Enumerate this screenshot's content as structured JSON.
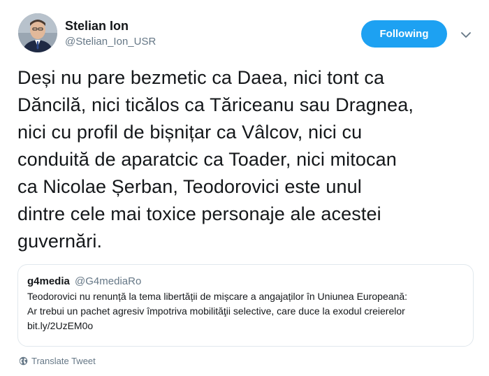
{
  "user": {
    "display_name": "Stelian Ion",
    "handle": "@Stelian_Ion_USR"
  },
  "follow_button": {
    "label": "Following",
    "color": "#1da1f2"
  },
  "tweet": {
    "lines": [
      "Deși nu pare bezmetic ca Daea, nici tont ca",
      "Dăncilă, nici ticălos ca Tăriceanu sau Dragnea,",
      "nici cu profil de bișnițar ca Vâlcov, nici cu",
      "conduită de aparatcic ca Toader, nici mitocan",
      "ca Nicolae Șerban, Teodorovici este unul",
      "dintre cele mai toxice personaje ale acestei",
      "guvernări."
    ]
  },
  "quote": {
    "name": "g4media",
    "handle": "@G4mediaRo",
    "lines": [
      "Teodorovici nu renunță la tema libertății de mișcare a angajaților în Uniunea Europeană:",
      "Ar trebui un pachet agresiv împotriva mobilităţii selective, care duce la exodul creierelor",
      "bit.ly/2UzEM0o"
    ]
  },
  "translate": {
    "label": "Translate Tweet",
    "icon": "globe-icon"
  },
  "icons": {
    "caret": "chevron-down-icon",
    "avatar": "avatar"
  },
  "colors": {
    "text": "#14171a",
    "muted": "#657786",
    "border": "#e1e8ed",
    "accent": "#1da1f2"
  }
}
